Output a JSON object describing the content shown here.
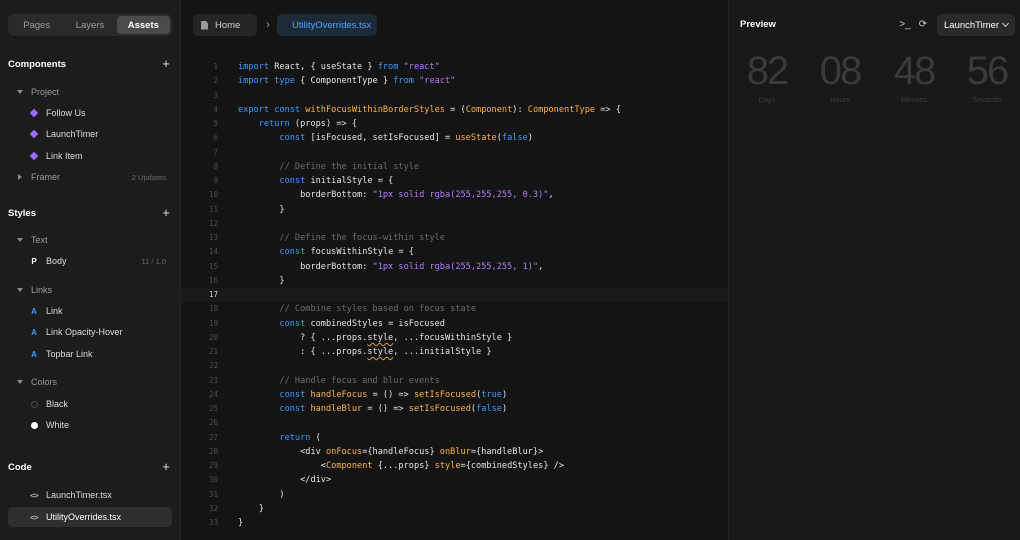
{
  "sidebar": {
    "tabs": [
      "Pages",
      "Layers",
      "Assets"
    ],
    "components": {
      "title": "Components",
      "groups": {
        "project": "Project",
        "framer": "Framer",
        "framer_meta": "2 Updates"
      },
      "items": [
        "Follow Us",
        "LaunchTimer",
        "Link Item"
      ]
    },
    "styles": {
      "title": "Styles",
      "text_group": "Text",
      "body": {
        "label": "Body",
        "meta": "11 / 1.0"
      },
      "links_group": "Links",
      "links": [
        "Link",
        "Link Opacity-Hover",
        "Topbar Link"
      ],
      "colors_group": "Colors",
      "colors": [
        "Black",
        "White"
      ]
    },
    "code": {
      "title": "Code",
      "files": [
        "LaunchTimer.tsx",
        "UtilityOverrides.tsx"
      ]
    }
  },
  "editor": {
    "tabs": {
      "home": "Home",
      "file": "UtilityOverrides.tsx"
    },
    "line_numbers": [
      "1",
      "2",
      "3",
      "4",
      "5",
      "6",
      "7",
      "8",
      "9",
      "10",
      "11",
      "12",
      "13",
      "14",
      "15",
      "16",
      "17",
      "18",
      "19",
      "20",
      "21",
      "22",
      "23",
      "24",
      "25",
      "26",
      "27",
      "28",
      "29",
      "30",
      "31",
      "32",
      "33"
    ]
  },
  "preview": {
    "title": "Preview",
    "component_select": "LaunchTimer",
    "timer": [
      {
        "value": "82",
        "unit": "Days"
      },
      {
        "value": "08",
        "unit": "Hours"
      },
      {
        "value": "48",
        "unit": "Minutes"
      },
      {
        "value": "56",
        "unit": "Seconds"
      }
    ]
  },
  "colors": {
    "accent_blue": "#3d9bff",
    "component_purple": "#9b6cff",
    "string_purple": "#b07cff",
    "function_orange": "#ffb347"
  }
}
